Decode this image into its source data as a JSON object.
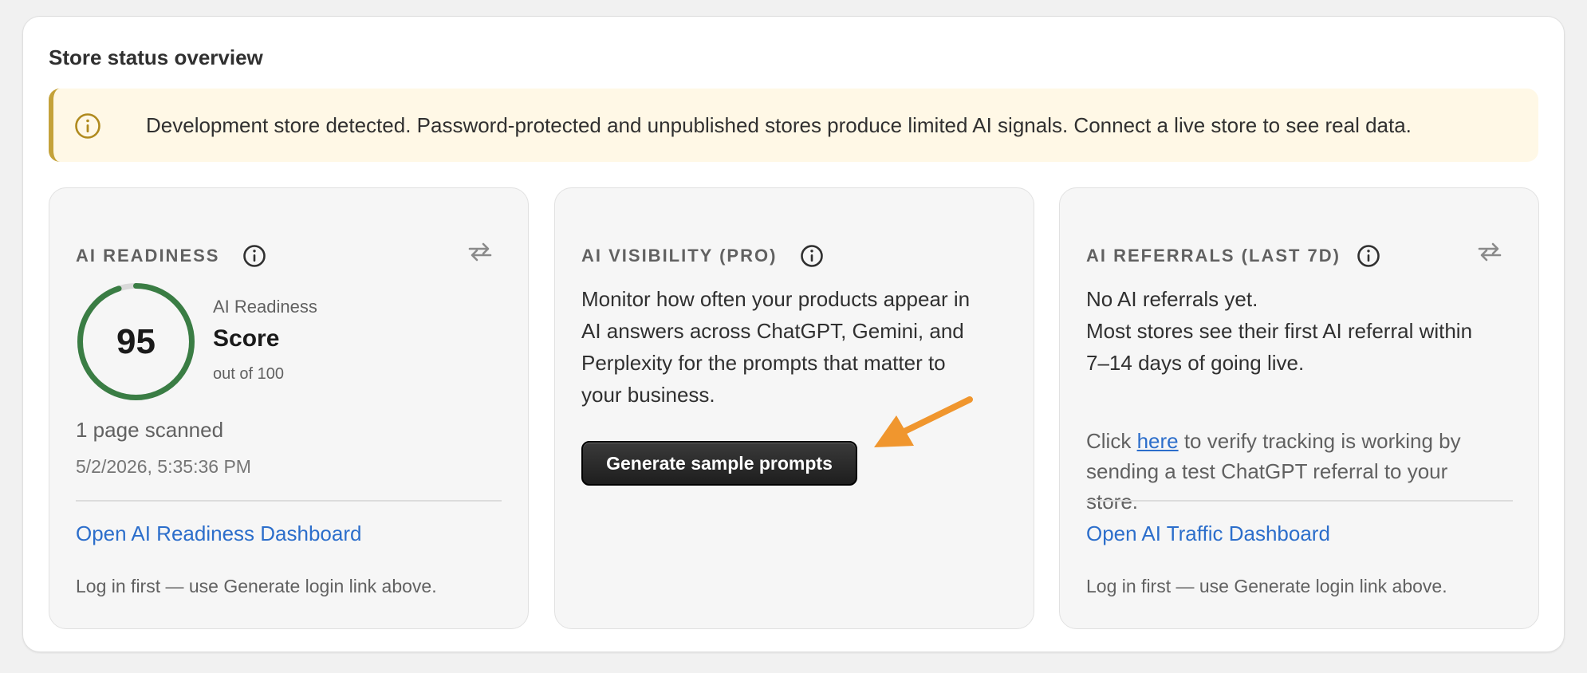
{
  "overview": {
    "title": "Store status overview"
  },
  "banner": {
    "icon": "info-circle-icon",
    "text": "Development store detected. Password-protected and unpublished stores produce limited AI signals. Connect a live store to see real data.",
    "accent_color": "#c4a23a",
    "background": "#fff8e6"
  },
  "readiness_card": {
    "label": "AI READINESS",
    "score": "95",
    "score_percent": 95,
    "score_label": "AI Readiness",
    "score_title": "Score",
    "score_sub": "out of 100",
    "pages_scanned": "1 page scanned",
    "scanned_at": "5/2/2026, 5:35:36 PM",
    "dashboard_link": "Open AI Readiness Dashboard",
    "login_note": "Log in first — use Generate login link above.",
    "gauge_color": "#3a7d44"
  },
  "visibility_card": {
    "label": "AI VISIBILITY (PRO)",
    "description_lines": [
      "Monitor how often your products appear in",
      "AI answers across ChatGPT, Gemini, and",
      "Perplexity for the prompts that matter to",
      "your business."
    ],
    "button_label": "Generate sample prompts"
  },
  "referrals_card": {
    "label": "AI REFERRALS (LAST 7D)",
    "status_lines": [
      "No AI referrals yet.",
      "Most stores see their first AI referral within",
      "7–14 days of going live."
    ],
    "verify_prefix": "Click ",
    "verify_link": "here",
    "verify_suffix": " to verify tracking is working by sending a test ChatGPT referral to your store.",
    "dashboard_link": "Open AI Traffic Dashboard",
    "login_note": "Log in first — use Generate login link above."
  },
  "colors": {
    "link": "#2c6ecb",
    "annotation_arrow": "#f0962e"
  }
}
